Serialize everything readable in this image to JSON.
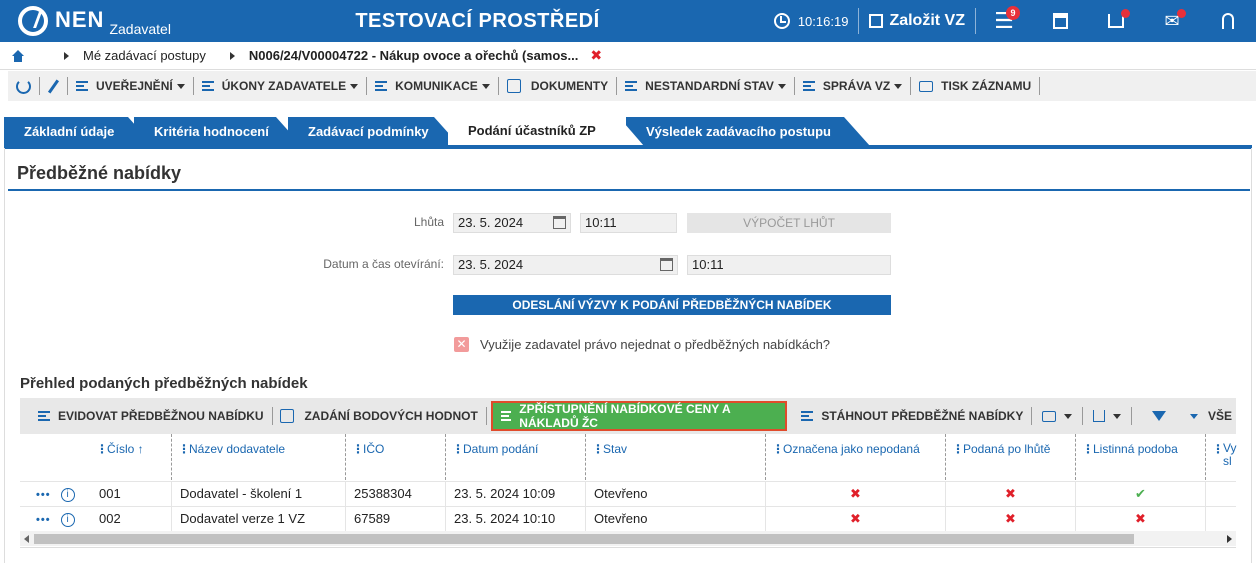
{
  "app": {
    "logo": "NEN",
    "logo_sub": "Zadavatel",
    "env_title": "TESTOVACÍ PROSTŘEDÍ",
    "time": "10:16:19",
    "create_vz": "Založit VZ",
    "menu_badge": "9"
  },
  "breadcrumb": {
    "item1": "Mé zadávací postupy",
    "current": "N006/24/V00004722 - Nákup ovoce a ořechů (samos...",
    "close": "✖"
  },
  "toolbar": {
    "uverejneni": "UVEŘEJNĚNÍ",
    "ukony": "ÚKONY ZADAVATELE",
    "komunikace": "KOMUNIKACE",
    "dokumenty": "DOKUMENTY",
    "nestandardni": "NESTANDARDNÍ STAV",
    "sprava": "SPRÁVA VZ",
    "tisk": "TISK ZÁZNAMU"
  },
  "tabs": [
    "Základní údaje",
    "Kritéria hodnocení",
    "Zadávací podmínky",
    "Podání účastníků ZP",
    "Výsledek zadávacího postupu"
  ],
  "section": {
    "title": "Předběžné nabídky",
    "lhuta_label": "Lhůta",
    "lhuta_date": "23. 5. 2024",
    "lhuta_time": "10:11",
    "vypocet_btn": "VÝPOČET LHŮT",
    "otevirani_label": "Datum a čas otevírání:",
    "otevirani_date": "23. 5. 2024",
    "otevirani_time": "10:11",
    "odeslani_btn": "ODESLÁNÍ VÝZVY K PODÁNÍ PŘEDBĚŽNÝCH NABÍDEK",
    "checkbox_label": "Využije zadavatel právo nejednat o předběžných nabídkách?"
  },
  "grid": {
    "title": "Přehled podaných předběžných nabídek",
    "toolbar": {
      "evidovat": "EVIDOVAT PŘEDBĚŽNOU NABÍDKU",
      "zadani": "ZADÁNÍ BODOVÝCH HODNOT",
      "zpristupneni": "ZPŘÍSTUPNĚNÍ NABÍDKOVÉ CENY A NÁKLADŮ ŽC",
      "stahnout": "STÁHNOUT PŘEDBĚŽNÉ NABÍDKY",
      "vse": "VŠE"
    },
    "columns": [
      "Číslo ↑",
      "Název dodavatele",
      "IČO",
      "Datum podání",
      "Stav",
      "Označena jako nepodaná",
      "Podaná po lhůtě",
      "Listinná podoba",
      "Vy sl"
    ],
    "rows": [
      {
        "cislo": "001",
        "nazev": "Dodavatel - školení 1",
        "ico": "25388304",
        "datum": "23. 5. 2024 10:09",
        "stav": "Otevřeno",
        "nepodana": "✖",
        "po_lhute": "✖",
        "listinna": "✔"
      },
      {
        "cislo": "002",
        "nazev": "Dodavatel verze 1 VZ",
        "ico": "67589",
        "datum": "23. 5. 2024 10:10",
        "stav": "Otevřeno",
        "nepodana": "✖",
        "po_lhute": "✖",
        "listinna": "✖"
      }
    ]
  }
}
